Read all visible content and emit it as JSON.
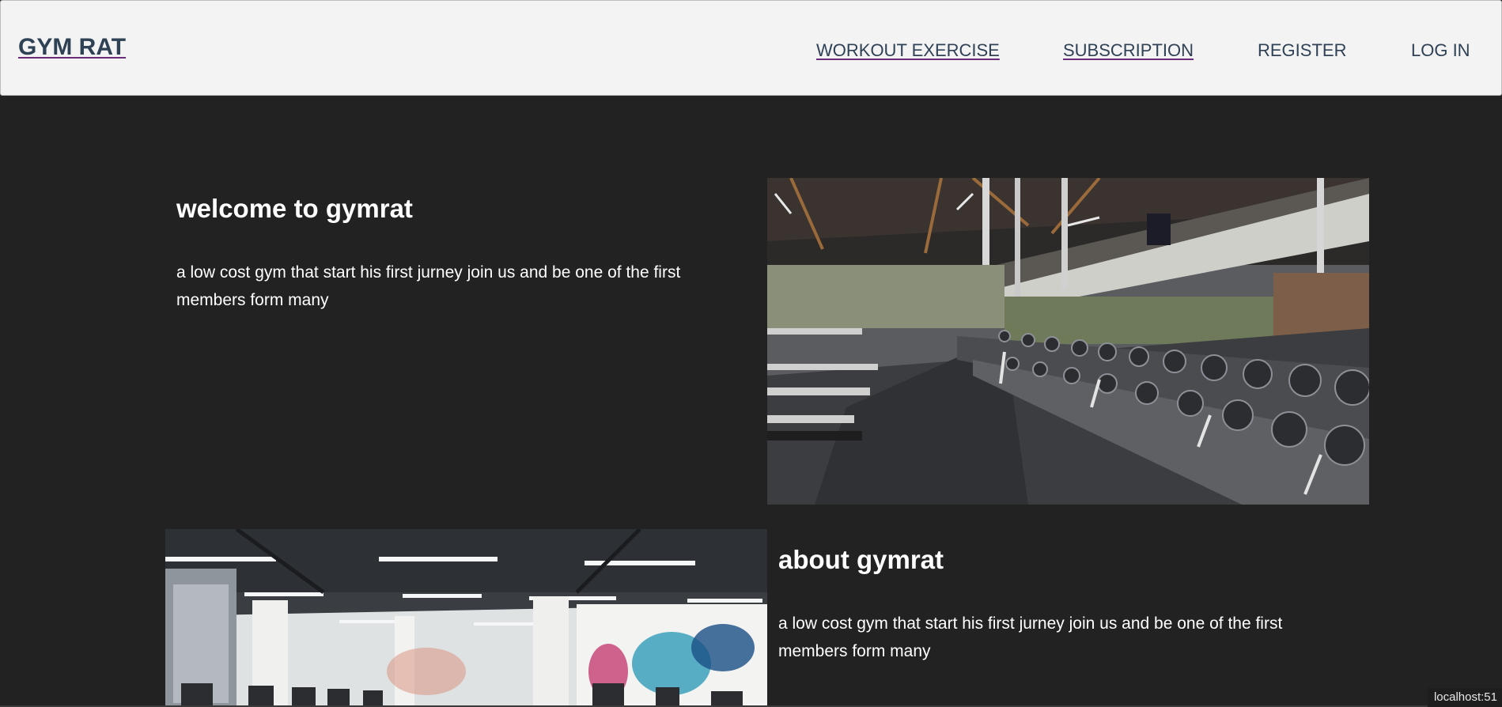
{
  "header": {
    "logo": "GYM RAT",
    "nav": {
      "workout": "WORKOUT EXERCISE",
      "subscription": "SUBSCRIPTION",
      "register": "REGISTER",
      "login": "LOG IN"
    }
  },
  "sections": {
    "welcome": {
      "title": "welcome to gymrat",
      "text": "a low cost gym that start his first jurney join us and be one of the first members form many"
    },
    "about": {
      "title": "about gymrat",
      "text": "a low cost gym that start his first jurney join us and be one of the first members form many"
    }
  },
  "status_bar": {
    "url": "localhost:51"
  },
  "colors": {
    "navbar_bg": "#f3f3f3",
    "nav_text": "#2f4155",
    "underline": "#6a2b7a",
    "page_bg": "#222222",
    "text": "#ffffff"
  }
}
